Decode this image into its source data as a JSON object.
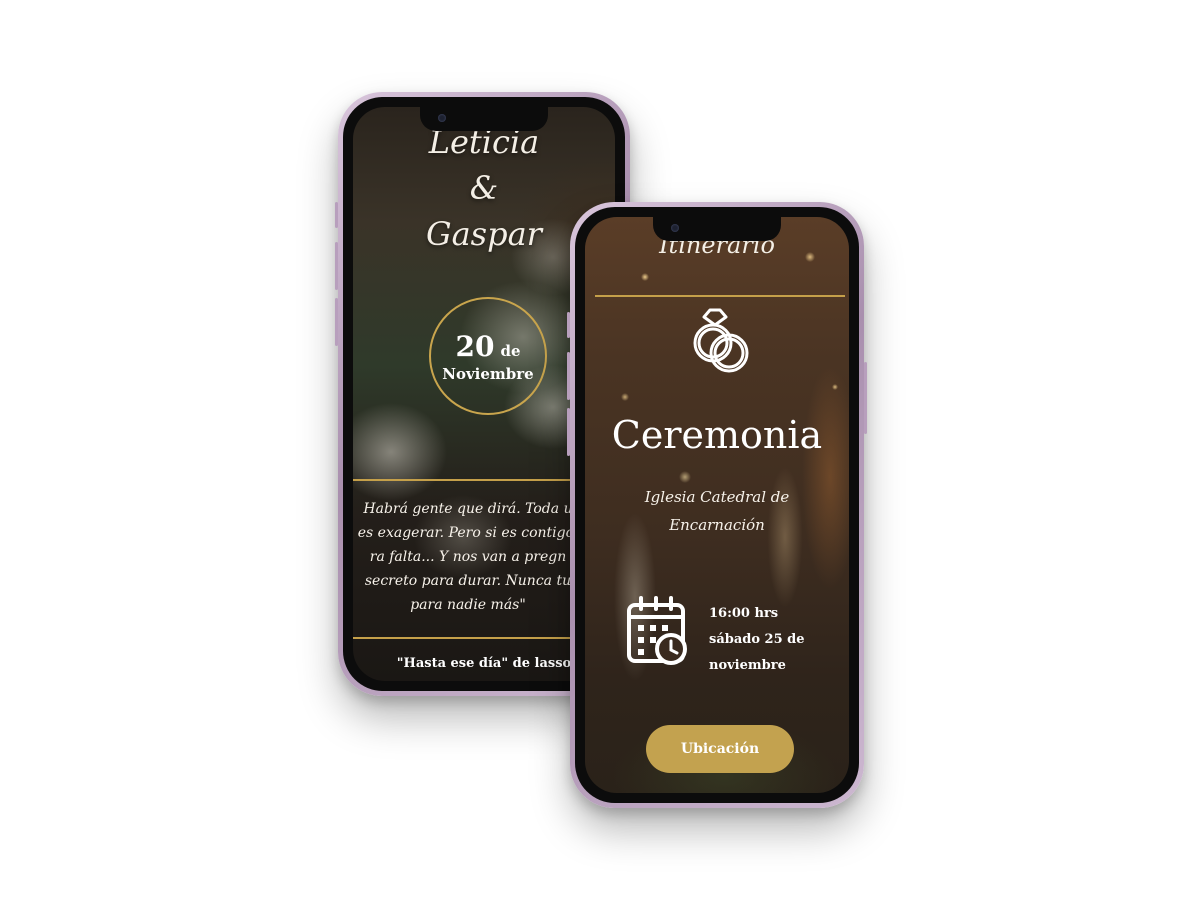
{
  "invitation": {
    "name_one": "Leticia",
    "ampersand": "&",
    "name_two": "Gaspar",
    "date_day": "20",
    "date_de": "de",
    "date_month": "Noviembre",
    "quote_lines": [
      "Habrá gente que dirá. Toda u",
      "es exagerar. Pero si es contigo.",
      "ra falta... Y nos van a pregn",
      "secreto para durar. Nunca tu",
      "para nadie más\""
    ],
    "footer_quote": "\"Hasta ese día\" de lasso"
  },
  "itinerary": {
    "title": "Itinerario",
    "event_title": "Ceremonia",
    "venue_lines": [
      "Iglesia Catedral de",
      "Encarnación"
    ],
    "time": "16:00 hrs",
    "date_line_1": "sábado 25 de",
    "date_line_2": "noviembre",
    "location_button": "Ubicación"
  },
  "icons": {
    "rings": "wedding-rings-icon",
    "calendar": "calendar-clock-icon"
  },
  "colors": {
    "gold": "#c5a04a",
    "button_gold": "#c3a24f",
    "text_light": "#f4efe6"
  }
}
